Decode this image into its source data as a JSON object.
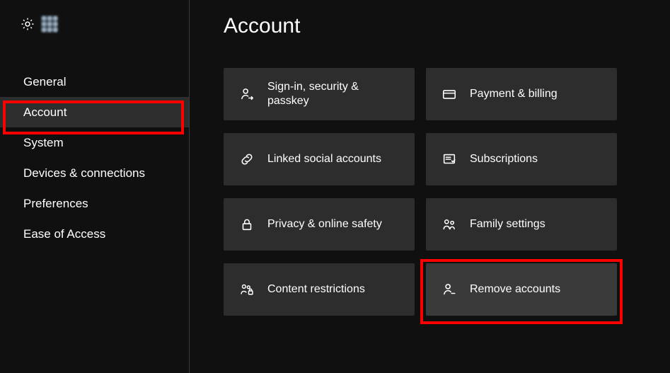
{
  "page": {
    "title": "Account"
  },
  "sidebar": {
    "items": [
      {
        "label": "General"
      },
      {
        "label": "Account"
      },
      {
        "label": "System"
      },
      {
        "label": "Devices & connections"
      },
      {
        "label": "Preferences"
      },
      {
        "label": "Ease of Access"
      }
    ]
  },
  "tiles": [
    {
      "label": "Sign-in, security & passkey"
    },
    {
      "label": "Payment & billing"
    },
    {
      "label": "Linked social accounts"
    },
    {
      "label": "Subscriptions"
    },
    {
      "label": "Privacy & online safety"
    },
    {
      "label": "Family settings"
    },
    {
      "label": "Content restrictions"
    },
    {
      "label": "Remove accounts"
    }
  ]
}
